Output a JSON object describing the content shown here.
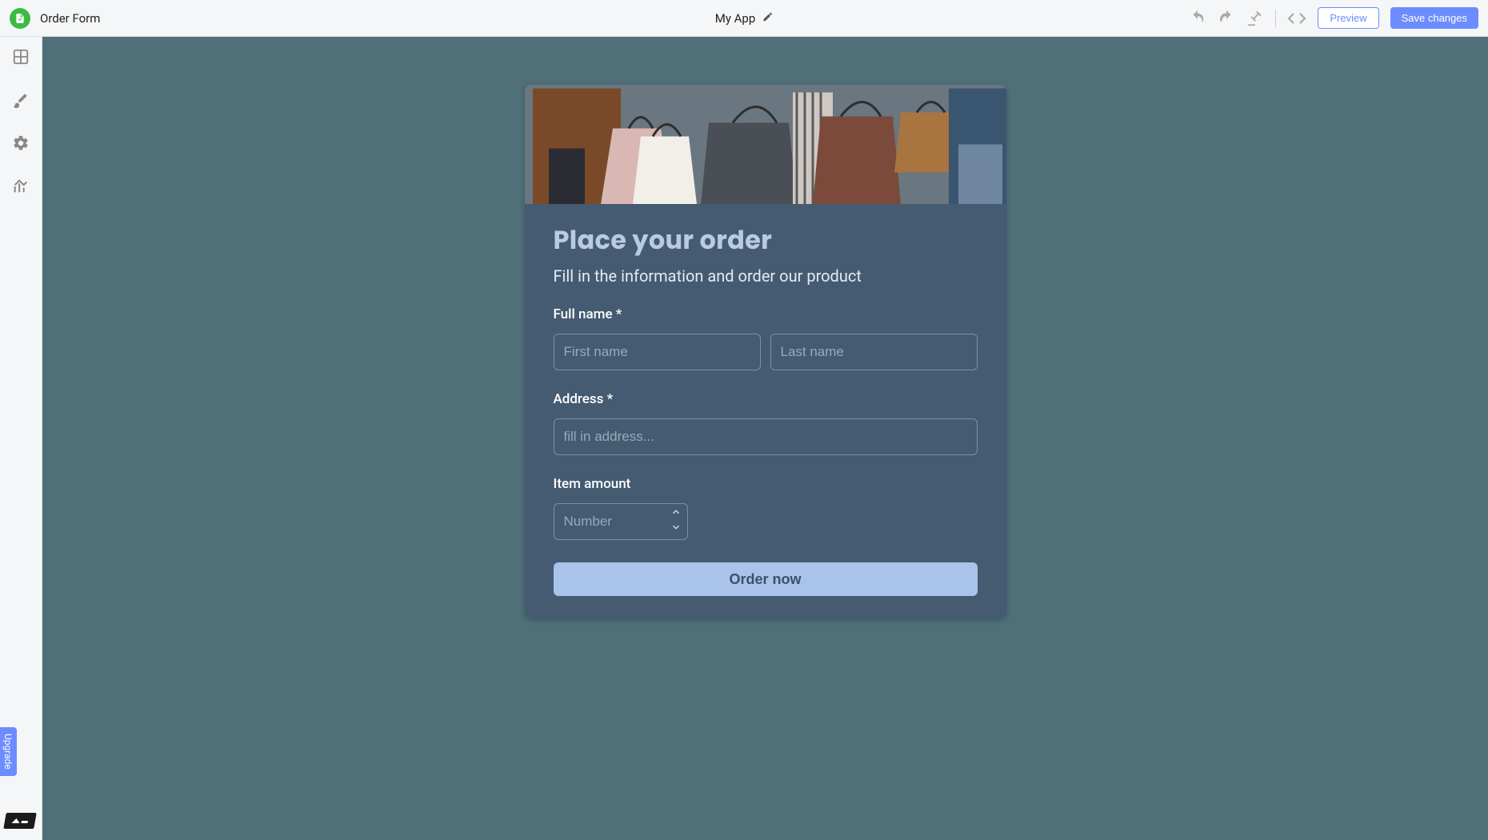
{
  "topbar": {
    "page_name": "Order Form",
    "app_name": "My App",
    "preview_label": "Preview",
    "save_label": "Save changes"
  },
  "sidebar": {
    "upgrade_label": "Upgrade"
  },
  "form": {
    "title": "Place your order",
    "subtitle": "Fill in the information and order our product",
    "fields": {
      "full_name": {
        "label": "Full name *",
        "first_placeholder": "First name",
        "last_placeholder": "Last name"
      },
      "address": {
        "label": "Address *",
        "placeholder": "fill in address..."
      },
      "item_amount": {
        "label": "Item amount",
        "placeholder": "Number"
      }
    },
    "submit_label": "Order now"
  },
  "colors": {
    "canvas": "#507079",
    "card": "#445b72",
    "accent_title": "#b9c9e6",
    "button": "#a9c3ea",
    "primary_btn": "#6c8cff"
  }
}
